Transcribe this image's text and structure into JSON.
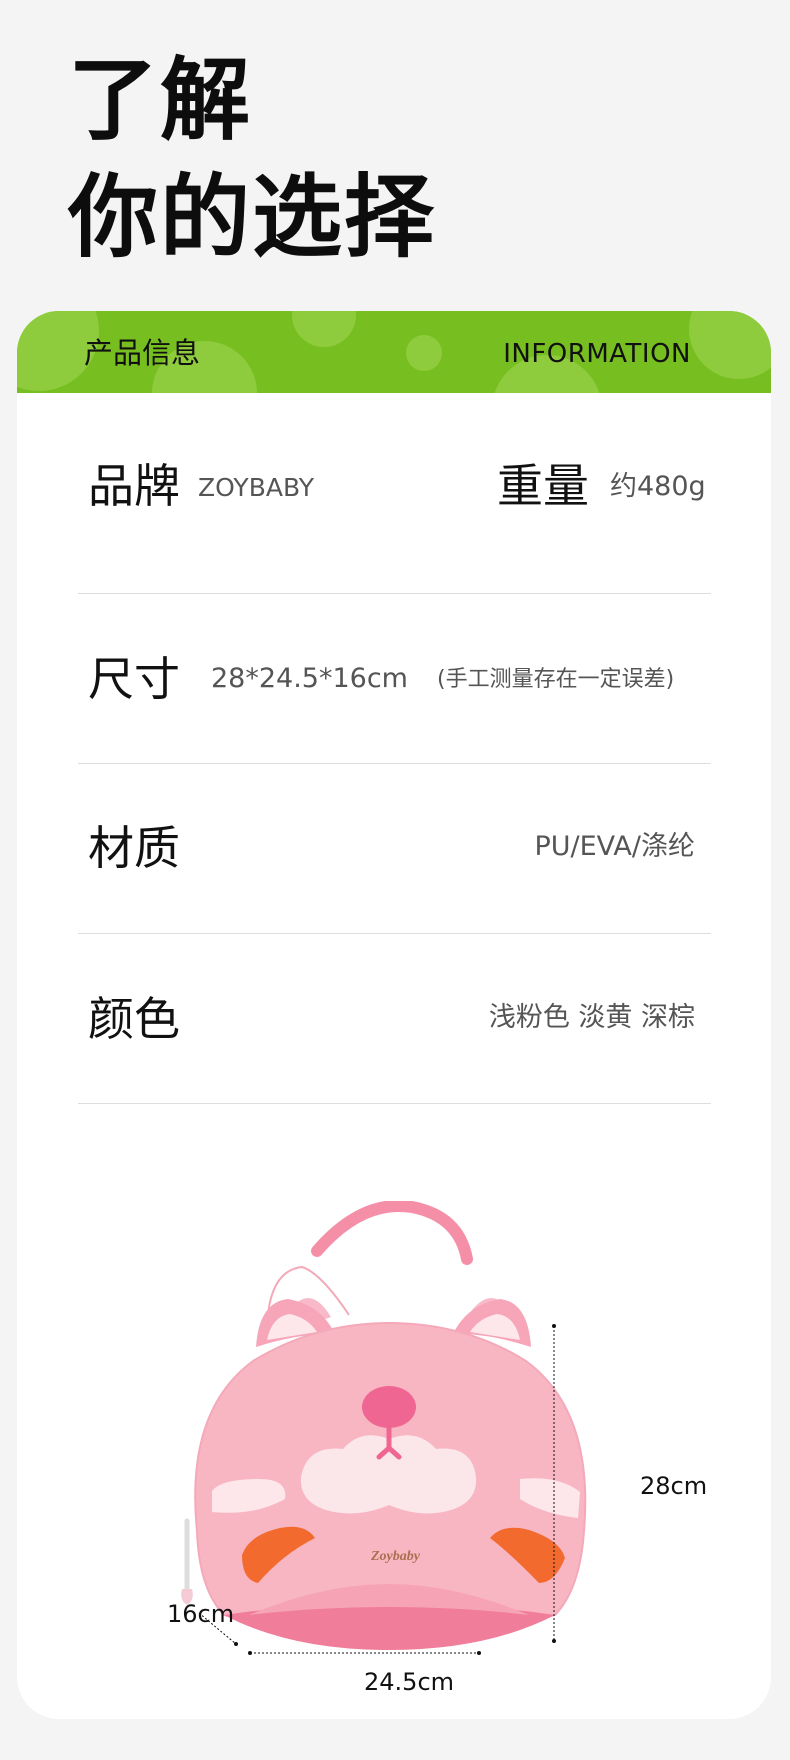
{
  "hero": {
    "line1": "了解",
    "line2": "你的选择"
  },
  "header": {
    "title_cn": "产品信息",
    "title_en": "INFORMATION"
  },
  "specs": {
    "brand_label": "品牌",
    "brand_value": "ZOYBABY",
    "weight_label": "重量",
    "weight_value": "约480g",
    "size_label": "尺寸",
    "size_value": "28*24.5*16cm",
    "size_note": "(手工测量存在一定误差)",
    "material_label": "材质",
    "material_value": "PU/EVA/涤纶",
    "color_label": "颜色",
    "color_value": "浅粉色 淡黄 深棕"
  },
  "product": {
    "logo_text": "Zoybaby",
    "height_label": "28cm",
    "width_label": "24.5cm",
    "depth_label": "16cm"
  },
  "colors": {
    "accent_green": "#77bf20",
    "bag_pink": "#f8b6c3",
    "bag_pink_dark": "#f07d9a",
    "cheek_orange": "#f26a2e"
  }
}
